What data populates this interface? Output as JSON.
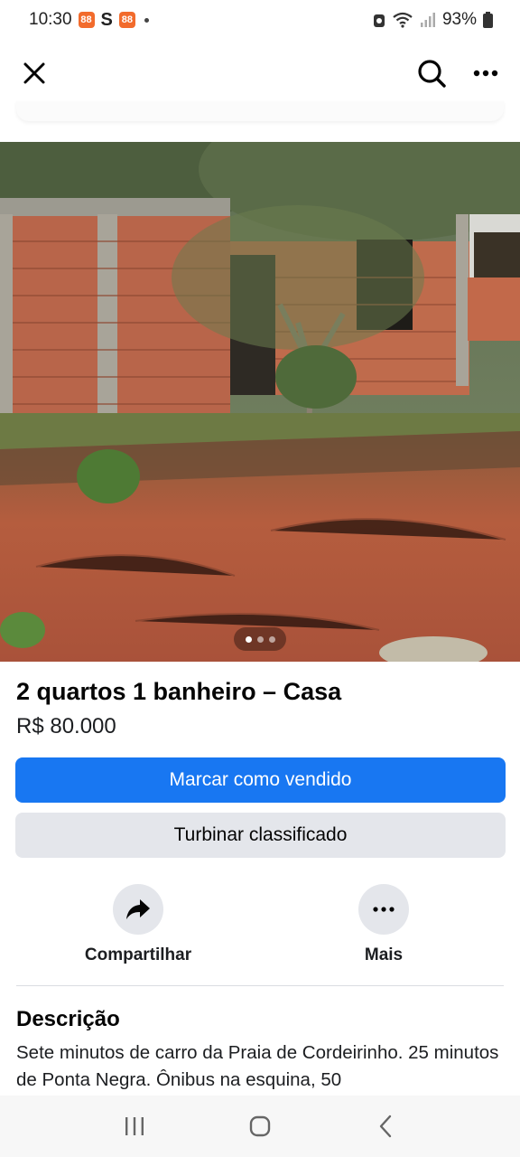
{
  "status_bar": {
    "time": "10:30",
    "notif_icons": [
      "notification-app-icon",
      "s-app-icon",
      "notification-app-icon"
    ],
    "s_glyph": "S",
    "notif_glyph": "88",
    "battery": "93%"
  },
  "app_bar": {
    "icons": [
      "close-icon",
      "search-icon",
      "more-horizontal-icon"
    ]
  },
  "photo": {
    "image_count": 3,
    "active_index": 0
  },
  "listing": {
    "title": "2 quartos 1 banheiro – Casa",
    "price": "R$ 80.000"
  },
  "buttons": {
    "mark_sold": "Marcar como vendido",
    "boost": "Turbinar classificado"
  },
  "actions": {
    "share_label": "Compartilhar",
    "more_label": "Mais"
  },
  "description": {
    "heading": "Descrição",
    "text": "Sete minutos de carro da Praia de Cordeirinho. 25 minutos de Ponta Negra. Ônibus na esquina, 50"
  },
  "colors": {
    "primary": "#1877f2",
    "secondary_button": "#e4e6eb",
    "text": "#050505"
  }
}
